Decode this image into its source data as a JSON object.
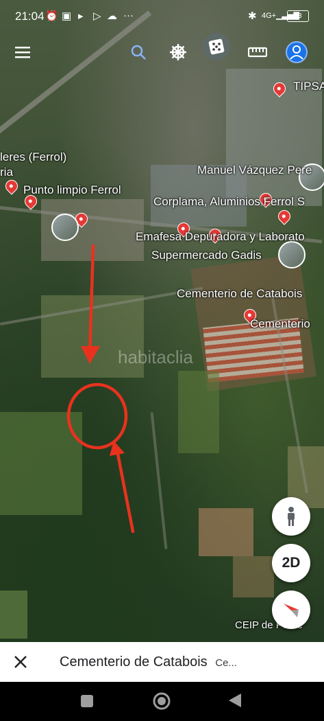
{
  "status_bar": {
    "time": "21:04",
    "battery": "73",
    "icons": [
      "alarm-icon",
      "notification-n-icon",
      "play-icon",
      "play-icon",
      "cloud-icon",
      "more-icon",
      "bluetooth-icon",
      "signal-icon",
      "battery-icon"
    ],
    "more": "···"
  },
  "toolbar": {
    "icons": [
      "menu-icon",
      "search-icon",
      "voyager-wheel-icon",
      "dice-icon",
      "ruler-icon",
      "account-icon"
    ]
  },
  "map": {
    "labels": [
      {
        "text": "TIPSA"
      },
      {
        "text": "leres (Ferrol)"
      },
      {
        "text": "ria"
      },
      {
        "text": "Punto limpio Ferrol"
      },
      {
        "text": "Manuel Vázquez Pere"
      },
      {
        "text": "Corplama, Aluminios Ferrol S"
      },
      {
        "text": "Emafesa Depuradora y Laborato"
      },
      {
        "text": "Supermercado Gadis"
      },
      {
        "text": "Cementerio de Catabois"
      },
      {
        "text": "Cementerio"
      },
      {
        "text": "CEIP de Ponte"
      }
    ],
    "watermark": "habitaclia",
    "annotation_color": "#e8321e"
  },
  "controls": {
    "view_mode": "2D",
    "icons": [
      "pegman-icon",
      "compass-icon"
    ]
  },
  "bottom_card": {
    "title": "Cementerio de Catabois",
    "subtitle": "Ce..."
  },
  "navbar": {
    "icons": [
      "recents-square-icon",
      "home-circle-icon",
      "back-triangle-icon"
    ]
  }
}
